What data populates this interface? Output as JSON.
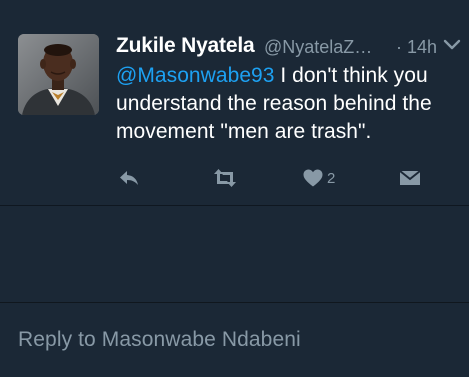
{
  "tweet": {
    "display_name": "Zukile Nyatela",
    "handle": "@NyatelaZ…",
    "separator": "·",
    "time": "14h",
    "menu_icon": "chevron-down-icon",
    "text": {
      "mention": "@Masonwabe93",
      "line1_rest": " I don't think you",
      "line2": "understand the reason behind the",
      "line3": "movement \"men are trash\"."
    },
    "actions": {
      "reply_icon": "reply-icon",
      "retweet_icon": "retweet-icon",
      "like_icon": "heart-icon",
      "like_count": "2",
      "dm_icon": "envelope-icon"
    }
  },
  "reply": {
    "placeholder": "Reply to Masonwabe Ndabeni"
  },
  "colors": {
    "background": "#1b2836",
    "divider": "#0f1720",
    "mention": "#1da1f2",
    "secondary_text": "#8899a6",
    "icon": "#8899a6"
  }
}
